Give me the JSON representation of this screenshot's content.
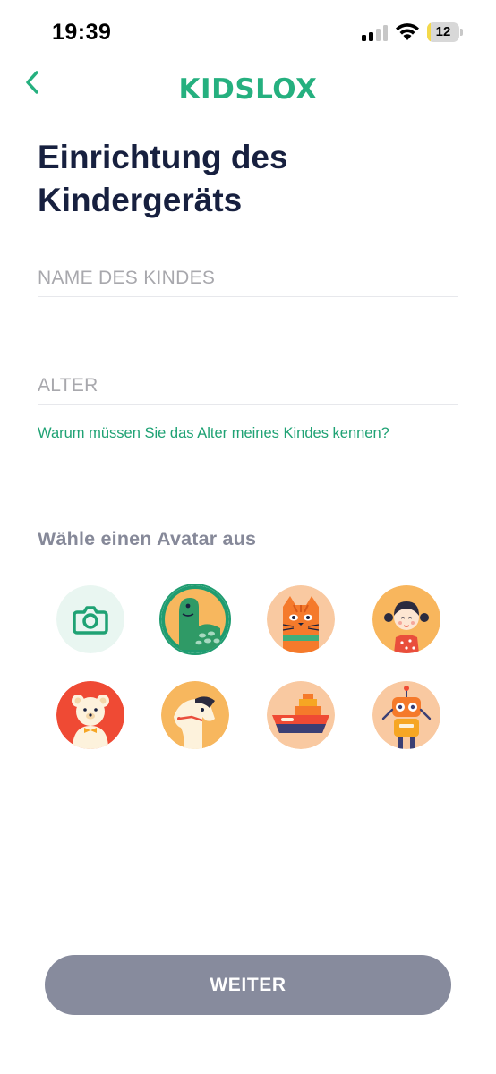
{
  "status_bar": {
    "time": "19:39",
    "battery_level": "12",
    "battery_fraction": 0.12,
    "battery_color": "#f4d94a"
  },
  "header": {
    "logo_text": "KIDSLOX",
    "brand_color": "#25b07f",
    "back_icon": "chevron-left-icon"
  },
  "page_title": "Einrichtung des Kindergeräts",
  "form": {
    "name_placeholder": "NAME DES KINDES",
    "name_value": "",
    "age_placeholder": "ALTER",
    "age_value": "",
    "age_help_link": "Warum müssen Sie das Alter meines Kindes kennen?"
  },
  "avatar_section": {
    "heading": "Wähle einen Avatar aus",
    "avatars": [
      {
        "name": "camera",
        "icon": "camera-icon",
        "selected": false
      },
      {
        "name": "dinosaur",
        "icon": "dinosaur-icon",
        "selected": true
      },
      {
        "name": "cat",
        "icon": "cat-icon",
        "selected": false
      },
      {
        "name": "doll",
        "icon": "doll-icon",
        "selected": false
      },
      {
        "name": "teddy-bear",
        "icon": "teddy-bear-icon",
        "selected": false
      },
      {
        "name": "rocking-horse",
        "icon": "horse-icon",
        "selected": false
      },
      {
        "name": "ship",
        "icon": "ship-icon",
        "selected": false
      },
      {
        "name": "robot",
        "icon": "robot-icon",
        "selected": false
      }
    ]
  },
  "footer": {
    "next_label": "WEITER"
  },
  "colors": {
    "accent": "#1fa274",
    "title": "#17203f",
    "button_disabled": "#878b9d",
    "muted": "#868999"
  }
}
